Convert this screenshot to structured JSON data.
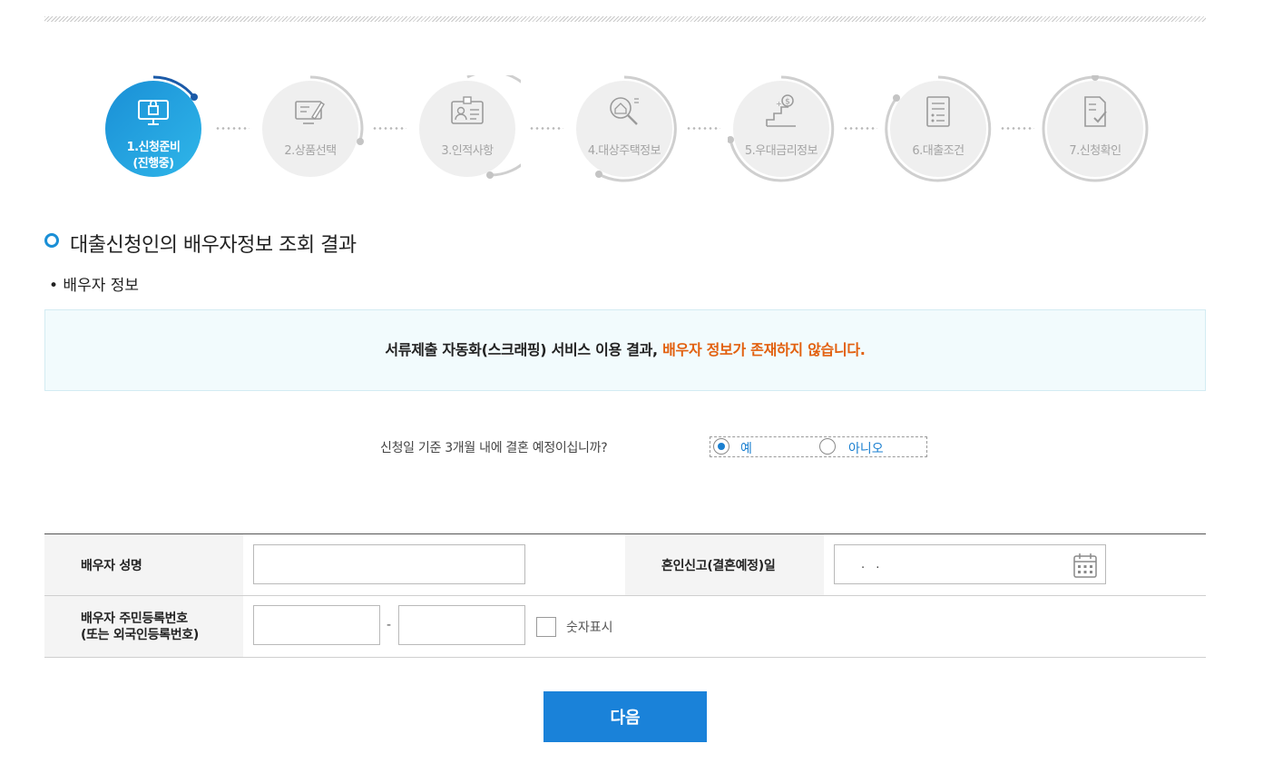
{
  "steps": [
    {
      "line1": "1.신청준비",
      "line2": "(진행중)",
      "icon": "monitor-lock-icon",
      "active": true
    },
    {
      "line1": "2.상품선택",
      "icon": "pc-select-icon"
    },
    {
      "line1": "3.인적사항",
      "icon": "id-card-icon"
    },
    {
      "line1": "4.대상주택정보",
      "icon": "house-search-icon"
    },
    {
      "line1": "5.우대금리정보",
      "icon": "dollar-stairs-icon"
    },
    {
      "line1": "6.대출조건",
      "icon": "document-list-icon"
    },
    {
      "line1": "7.신청확인",
      "icon": "document-check-icon"
    }
  ],
  "section": {
    "title": "대출신청인의 배우자정보 조회 결과",
    "subtitle": "• 배우자 정보"
  },
  "notice": {
    "text": "서류제출 자동화(스크래핑) 서비스 이용 결과, ",
    "highlight": "배우자 정보가 존재하지 않습니다."
  },
  "question": {
    "text": "신청일 기준 3개월 내에 결혼 예정이십니까?",
    "options": [
      "예",
      "아니오"
    ],
    "selected": "예"
  },
  "form": {
    "spouse_name_label": "배우자 성명",
    "spouse_name_value": "",
    "marriage_date_label": "혼인신고(결혼예정)일",
    "marriage_date_value": ". .",
    "rrn_label_line1": "배우자 주민등록번호",
    "rrn_label_line2": "(또는 외국인등록번호)",
    "rrn_front": "",
    "rrn_back": "",
    "rrn_dash": "-",
    "show_numbers_label": "숫자표시"
  },
  "next_button": "다음",
  "colors": {
    "accent": "#1a82d9",
    "highlight": "#e2600f",
    "notice_bg": "#f2fbfd"
  }
}
